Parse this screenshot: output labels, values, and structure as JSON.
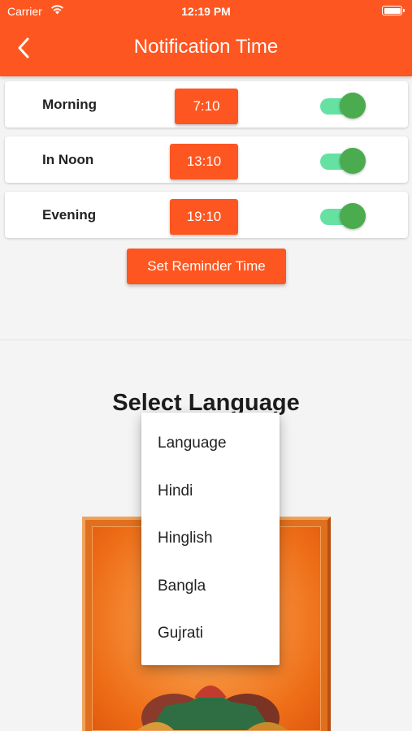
{
  "status_bar": {
    "carrier": "Carrier",
    "time": "12:19 PM"
  },
  "app_bar": {
    "title": "Notification Time",
    "back_icon": "chevron-left-icon"
  },
  "notifications": [
    {
      "label": "Morning",
      "time": "7:10",
      "enabled": true
    },
    {
      "label": "In Noon",
      "time": "13:10",
      "enabled": true
    },
    {
      "label": "Evening",
      "time": "19:10",
      "enabled": true
    }
  ],
  "set_button_label": "Set Reminder Time",
  "language": {
    "title": "Select Language",
    "options": [
      "Language",
      "Hindi",
      "Hinglish",
      "Bangla",
      "Gujrati"
    ]
  },
  "colors": {
    "accent": "#fe5620",
    "toggle_track": "#65e2a1",
    "toggle_thumb": "#4aac4e",
    "background": "#f4f4f4"
  }
}
